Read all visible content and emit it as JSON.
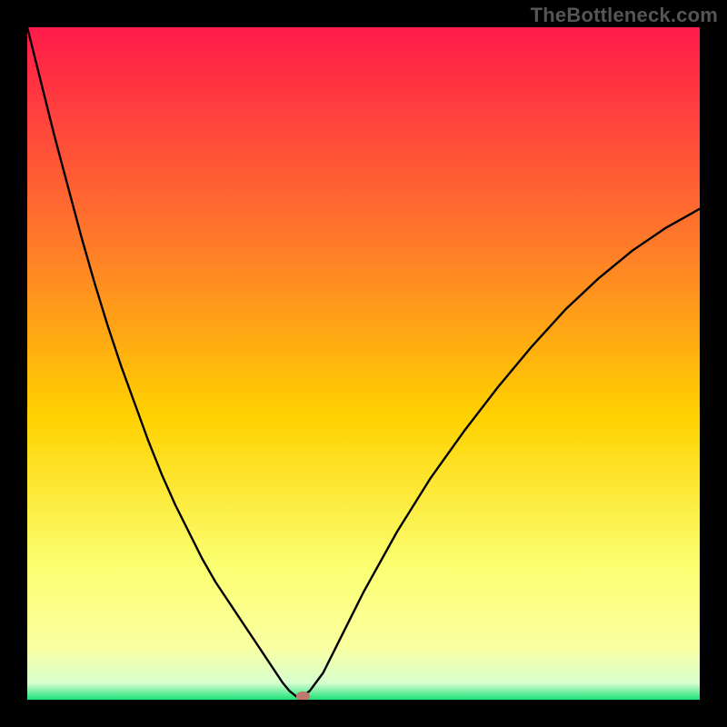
{
  "watermark": "TheBottleneck.com",
  "colors": {
    "frame": "#000000",
    "line": "#000000",
    "marker_fill": "#bf7a6f",
    "marker_stroke": "#bf7a6f",
    "gradient_top": "#ff1a4a",
    "gradient_mid1": "#ff7a2a",
    "gradient_mid2": "#ffd200",
    "gradient_mid3": "#fbff70",
    "gradient_band": "#fbffa0",
    "gradient_bottom": "#1de27a"
  },
  "chart_data": {
    "type": "line",
    "title": "",
    "xlabel": "",
    "ylabel": "",
    "xlim": [
      0,
      100
    ],
    "ylim": [
      0,
      100
    ],
    "grid": false,
    "legend": null,
    "annotations": [],
    "notch_x": 40,
    "marker": {
      "x": 41,
      "y": 0.5
    },
    "series": [
      {
        "name": "curve",
        "x": [
          0,
          2,
          4,
          6,
          8,
          10,
          12,
          14,
          16,
          18,
          20,
          22,
          24,
          26,
          28,
          30,
          32,
          34,
          36,
          37,
          38,
          39,
          40,
          41,
          42,
          44,
          46,
          48,
          50,
          55,
          60,
          65,
          70,
          75,
          80,
          85,
          90,
          95,
          100
        ],
        "y": [
          100,
          92,
          84,
          76.5,
          69,
          62,
          55.5,
          49.5,
          44,
          38.5,
          33.5,
          29,
          25,
          21,
          17.5,
          14.5,
          11.5,
          8.5,
          5.5,
          4,
          2.5,
          1.3,
          0.5,
          0.6,
          1.3,
          4,
          8,
          12,
          16,
          25,
          33,
          40,
          46.5,
          52.5,
          58,
          62.7,
          66.8,
          70.2,
          73
        ]
      }
    ]
  }
}
